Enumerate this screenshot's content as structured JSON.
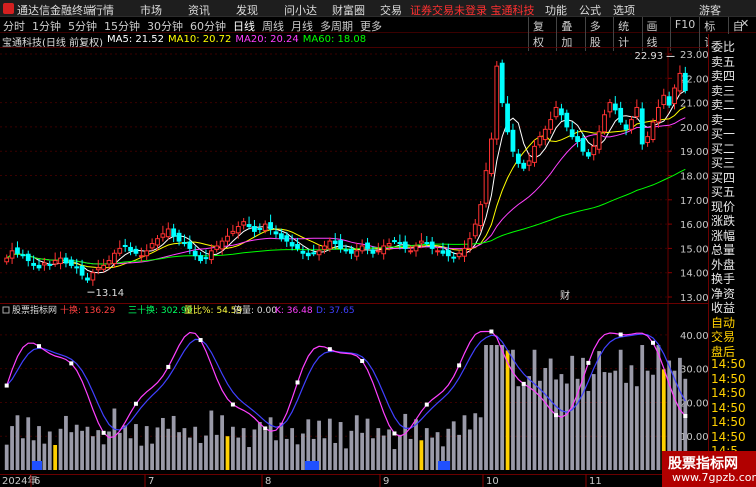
{
  "titlebar": {
    "app_title": "通达信金融终端",
    "menu": [
      "行情",
      "市场",
      "资讯",
      "发现",
      "问小达",
      "财富圈",
      "交易"
    ],
    "notice": "证券交易未登录",
    "account": "宝通科技",
    "right": [
      "功能",
      "公式",
      "选项",
      "游客"
    ]
  },
  "toolbar": {
    "periods": [
      "分时",
      "1分钟",
      "5分钟",
      "15分钟",
      "30分钟",
      "60分钟",
      "日线",
      "周线",
      "月线",
      "多周期",
      "更多"
    ],
    "active_period": "日线",
    "right_buttons": [
      "复权",
      "叠加",
      "多股",
      "统计",
      "画线",
      "F10",
      "标记",
      "自选"
    ]
  },
  "info": {
    "stock": "宝通科技(日线 前复权)",
    "ma5": "MA5: 21.52",
    "ma10": "MA10: 20.72",
    "ma20": "MA20: 20.24",
    "ma60": "MA60: 18.08"
  },
  "indicator_info": {
    "name": "股票指标网",
    "shihuan": "十换: 136.29",
    "sanshihuan": "三十换: 302.99",
    "liangbi": "量比%: 54.59",
    "beiliang": "倍量: 0.00",
    "k": "K: 36.48",
    "d": "D: 37.65"
  },
  "side_panel": [
    "委比",
    "卖五",
    "卖四",
    "卖三",
    "卖二",
    "卖一",
    "买一",
    "买二",
    "买三",
    "买四",
    "买五",
    "现价",
    "涨跌",
    "涨幅",
    "总量",
    "外盘",
    "换手",
    "净资",
    "收益",
    "自动",
    "交易",
    "盘后",
    "14:50",
    "14:50",
    "14:50",
    "14:50",
    "14:50",
    "14:50",
    "14:5"
  ],
  "price_axis": [
    "23.00",
    "22.00",
    "21.00",
    "20.00",
    "19.00",
    "18.00",
    "17.00",
    "16.00",
    "15.00",
    "14.00",
    "13.00"
  ],
  "indicator_axis": [
    "40.00",
    "30.00",
    "20.00",
    "10.00"
  ],
  "date_axis": [
    "2024年",
    "6",
    "7",
    "8",
    "9",
    "10",
    "11"
  ],
  "annotations": {
    "high": "22.93",
    "low": "13.14",
    "cai": "财"
  },
  "watermark": {
    "line1": "股票指标网",
    "line2": "www.7gpzb.com"
  },
  "colors": {
    "up": "#ff3232",
    "down": "#00ffff",
    "ma5": "#ffffff",
    "ma10": "#ffff00",
    "ma20": "#ff40ff",
    "ma60": "#00ff00"
  },
  "chart_data": {
    "type": "candlestick",
    "ylim": [
      13.0,
      23.0
    ],
    "closes": [
      14.6,
      14.9,
      14.8,
      14.7,
      14.5,
      14.3,
      14.2,
      14.4,
      14.3,
      14.5,
      14.6,
      14.4,
      14.3,
      14.2,
      13.9,
      13.7,
      14.0,
      14.2,
      14.3,
      14.5,
      14.8,
      15.0,
      15.1,
      14.9,
      14.8,
      14.7,
      14.9,
      15.2,
      15.4,
      15.6,
      15.8,
      15.5,
      15.3,
      15.2,
      15.0,
      14.7,
      14.5,
      14.6,
      14.9,
      15.1,
      15.3,
      15.5,
      15.7,
      15.9,
      16.1,
      15.9,
      15.7,
      15.8,
      16.0,
      15.8,
      15.6,
      15.4,
      15.3,
      15.1,
      15.0,
      14.8,
      14.7,
      14.8,
      14.9,
      15.1,
      15.3,
      15.2,
      15.0,
      14.9,
      14.8,
      14.9,
      15.1,
      15.0,
      14.8,
      14.9,
      15.1,
      15.2,
      15.3,
      15.2,
      15.0,
      14.9,
      15.1,
      15.3,
      15.2,
      15.0,
      14.9,
      14.8,
      14.7,
      14.6,
      14.8,
      15.0,
      15.4,
      16.0,
      16.8,
      18.2,
      19.5,
      22.5,
      21.0,
      19.8,
      19.0,
      18.5,
      18.3,
      18.6,
      19.2,
      19.6,
      19.9,
      20.3,
      20.8,
      20.5,
      20.0,
      19.6,
      19.4,
      19.0,
      18.8,
      19.2,
      19.8,
      20.5,
      21.0,
      20.7,
      20.2,
      19.9,
      20.3,
      20.8,
      19.3,
      19.6,
      20.2,
      20.8,
      21.3,
      20.9,
      21.6,
      22.2,
      21.5
    ]
  }
}
